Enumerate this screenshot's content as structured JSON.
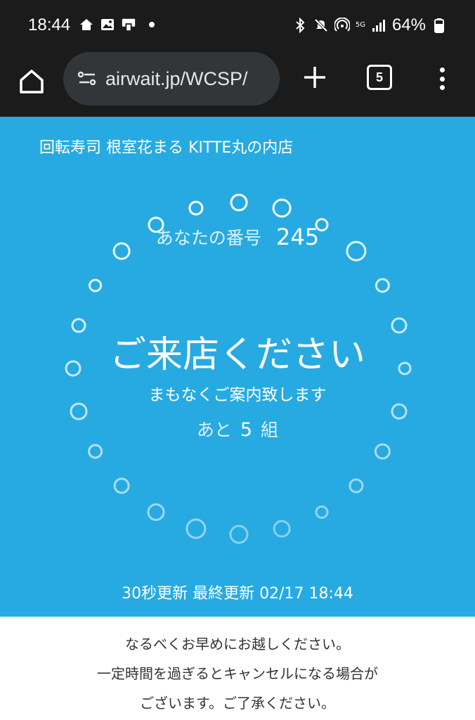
{
  "status_bar": {
    "time": "18:44",
    "network": "5G",
    "battery": "64%",
    "icons": [
      "home-icon",
      "image-icon",
      "device-icon",
      "notification-dot",
      "bluetooth-icon",
      "mute-icon",
      "hotspot-icon",
      "signal-icon",
      "battery-icon"
    ]
  },
  "browser": {
    "url": "airwait.jp/WCSP/",
    "tab_count": "5",
    "icons": [
      "home-icon",
      "site-settings-icon",
      "plus-icon",
      "tabs-icon",
      "more-vert-icon"
    ]
  },
  "page": {
    "store_name": "回転寿司 根室花まる KITTE丸の内店",
    "number_label": "あなたの番号",
    "number_value": "245",
    "headline": "ご来店ください",
    "subline": "まもなくご案内致します",
    "remaining_prefix": "あと",
    "remaining_count": "5",
    "remaining_suffix": "組",
    "update_interval": "30秒更新",
    "last_update_label": "最終更新",
    "last_update_value": "02/17 18:44"
  },
  "notice": {
    "line1": "なるべくお早めにお越しください。",
    "line2": "一定時間を過ぎるとキャンセルになる場合が",
    "line3": "ございます。ご了承ください。"
  },
  "colors": {
    "brand_blue": "#27aae1",
    "dark_bar": "#1b1b1b",
    "url_field": "#333638"
  }
}
